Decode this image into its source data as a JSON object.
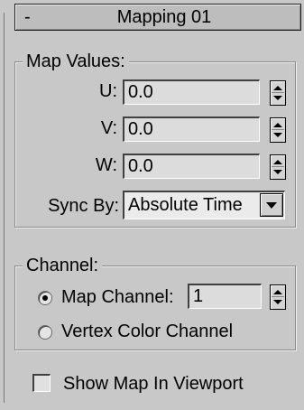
{
  "rollout": {
    "collapse_symbol": "-",
    "title": "Mapping 01"
  },
  "map_values": {
    "group_title": "Map Values:",
    "u_label": "U:",
    "u_value": "0.0",
    "v_label": "V:",
    "v_value": "0.0",
    "w_label": "W:",
    "w_value": "0.0",
    "sync_label": "Sync By:",
    "sync_value": "Absolute Time"
  },
  "channel": {
    "group_title": "Channel:",
    "map_channel_label": "Map Channel:",
    "map_channel_value": "1",
    "map_channel_selected": true,
    "vertex_color_label": "Vertex Color Channel",
    "vertex_color_selected": false
  },
  "show_map": {
    "label": "Show Map In Viewport",
    "checked": false
  },
  "colors": {
    "panel_bg": "#c8c8c8",
    "field_bg": "#dcdcdc"
  },
  "icons": {
    "spinner": "spinner-icon",
    "dropdown_arrow": "chevron-down-icon",
    "radio": "radio-icon",
    "checkbox": "checkbox-icon"
  }
}
